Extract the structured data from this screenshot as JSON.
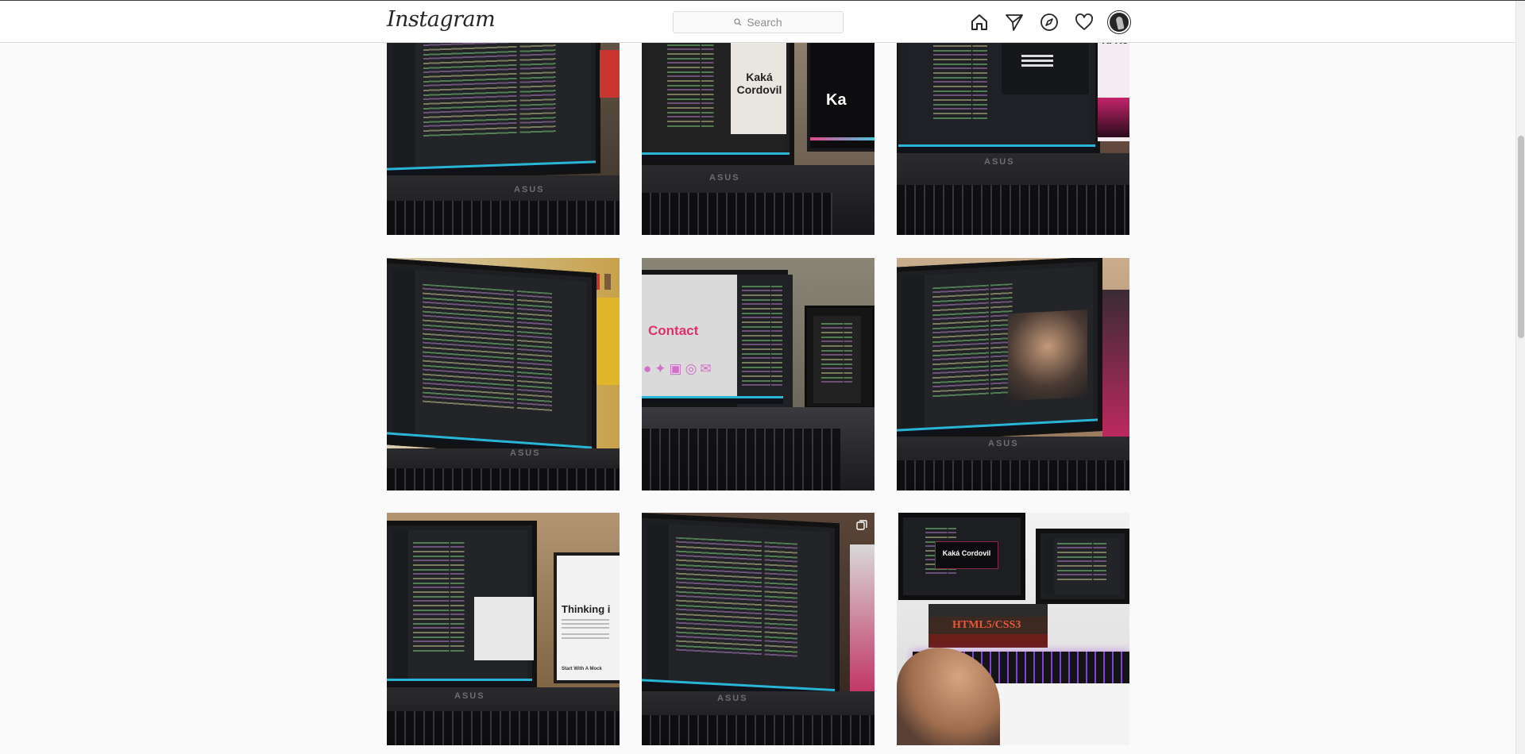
{
  "header": {
    "logo_text": "Instagram",
    "search_placeholder": "Search"
  },
  "nav_icons": [
    "home-icon",
    "direct-messages-icon",
    "explore-icon",
    "activity-heart-icon",
    "profile-avatar"
  ],
  "colors": {
    "header_bg": "#ffffff",
    "page_bg": "#fafafa",
    "border": "#dbdbdb",
    "text_dark": "#262626",
    "placeholder": "#8e8e8e"
  },
  "posts": [
    {
      "id": "post-1",
      "screen_text": ""
    },
    {
      "id": "post-2",
      "screen_text": "Kaká Cordovil",
      "screen_text_2": "Ka"
    },
    {
      "id": "post-3",
      "screen_text": "Tu Re"
    },
    {
      "id": "post-4",
      "screen_text": ""
    },
    {
      "id": "post-5",
      "screen_text": "Contact"
    },
    {
      "id": "post-6",
      "screen_text": ""
    },
    {
      "id": "post-7",
      "screen_text": "Thinking i",
      "screen_text_2": "Start With A Mock"
    },
    {
      "id": "post-8",
      "screen_text": "",
      "multi_photo": true
    },
    {
      "id": "post-9",
      "screen_text": "Kaká Cordovil",
      "book_text": "HTML5/CSS3"
    }
  ]
}
